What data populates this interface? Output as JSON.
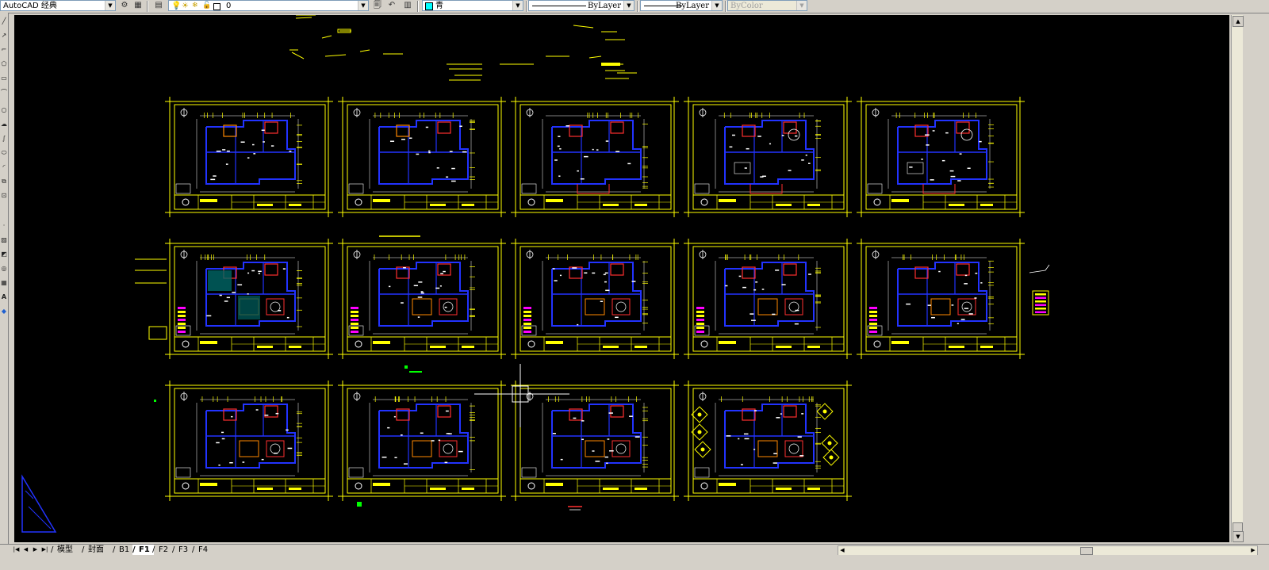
{
  "workspace": {
    "value": "AutoCAD 经典"
  },
  "layer": {
    "value": "0"
  },
  "color": {
    "value": "青",
    "swatch": "#00ffff"
  },
  "linetype": {
    "value": "ByLayer"
  },
  "lineweight": {
    "value": "ByLayer"
  },
  "plotstyle": {
    "value": "ByColor"
  },
  "toolbar_icons": [
    "workspace-settings-icon",
    "layer-manager-icon",
    "lightbulb-icon",
    "sun-icon",
    "lock-icon",
    "color-square-icon",
    "make-current-layer-icon",
    "layer-previous-icon",
    "layer-states-icon"
  ],
  "layout_tabs": {
    "items": [
      "模型",
      "封面",
      "B1",
      "F1",
      "F2",
      "F3",
      "F4"
    ],
    "active": "F1"
  },
  "sheet_grid": {
    "rows": 3,
    "cols": 5,
    "count": 14
  },
  "colors": {
    "canvas": "#000000",
    "frame": "#ffff00",
    "wall": "#2233ff",
    "accent_red": "#ff3030",
    "accent_orange": "#ff8800",
    "white": "#ffffff",
    "magenta": "#ff00ff",
    "green": "#00ff00",
    "cyan": "#00ffff"
  }
}
